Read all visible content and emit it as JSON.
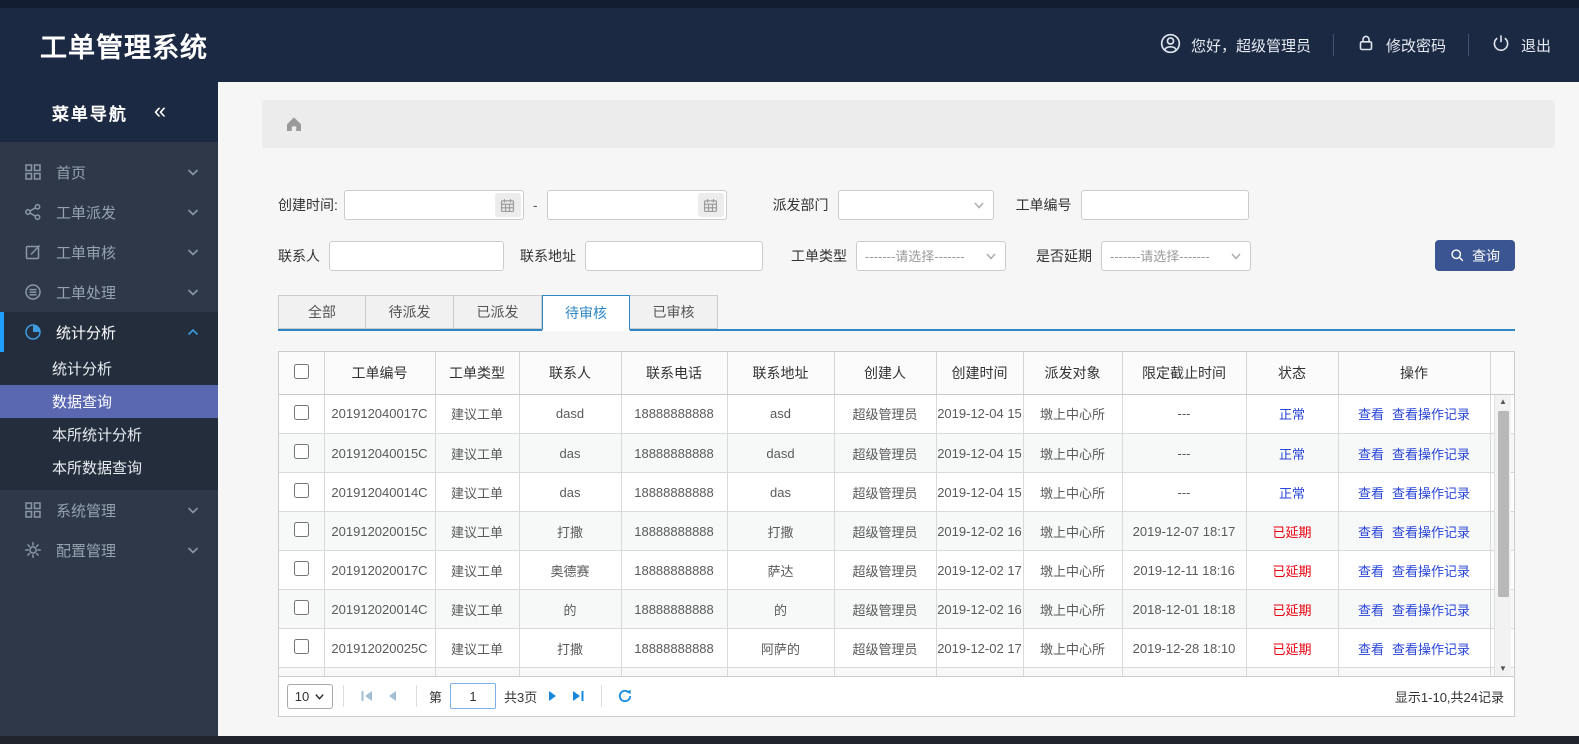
{
  "header": {
    "title": "工单管理系统",
    "greeting": "您好，超级管理员",
    "change_password": "修改密码",
    "logout": "退出"
  },
  "sidebar": {
    "title": "菜单导航",
    "collapse_glyph": "«",
    "items": [
      {
        "label": "首页",
        "icon": "grid-icon"
      },
      {
        "label": "工单派发",
        "icon": "share-icon"
      },
      {
        "label": "工单审核",
        "icon": "edit-icon"
      },
      {
        "label": "工单处理",
        "icon": "process-icon"
      },
      {
        "label": "统计分析",
        "icon": "pie-icon",
        "active": true,
        "expanded": true
      },
      {
        "label": "系统管理",
        "icon": "modules-icon"
      },
      {
        "label": "配置管理",
        "icon": "gear-icon"
      }
    ],
    "submenu": {
      "parent": "统计分析",
      "items": [
        {
          "label": "统计分析",
          "selected": false
        },
        {
          "label": "数据查询",
          "selected": true
        },
        {
          "label": "本所统计分析",
          "selected": false
        },
        {
          "label": "本所数据查询",
          "selected": false
        }
      ]
    }
  },
  "filters": {
    "create_time_label": "创建时间:",
    "range_separator": "-",
    "dispatch_dept_label": "派发部门",
    "order_no_label": "工单编号",
    "contact_label": "联系人",
    "address_label": "联系地址",
    "order_type_label": "工单类型",
    "delay_label": "是否延期",
    "select_placeholder": "-------请选择-------",
    "search_button": "查询"
  },
  "tabs": [
    {
      "label": "全部",
      "active": false
    },
    {
      "label": "待派发",
      "active": false
    },
    {
      "label": "已派发",
      "active": false
    },
    {
      "label": "待审核",
      "active": true
    },
    {
      "label": "已审核",
      "active": false
    }
  ],
  "table": {
    "columns": [
      "工单编号",
      "工单类型",
      "联系人",
      "联系电话",
      "联系地址",
      "创建人",
      "创建时间",
      "派发对象",
      "限定截止时间",
      "状态",
      "操作"
    ],
    "action_view": "查看",
    "action_view_log": "查看操作记录",
    "rows": [
      {
        "order_no": "201912040017C",
        "type": "建议工单",
        "contact": "dasd",
        "phone": "18888888888",
        "address": "asd",
        "creator": "超级管理员",
        "created": "2019-12-04 15",
        "target": "墩上中心所",
        "deadline": "---",
        "status": "正常",
        "status_class": "normal"
      },
      {
        "order_no": "201912040015C",
        "type": "建议工单",
        "contact": "das",
        "phone": "18888888888",
        "address": "dasd",
        "creator": "超级管理员",
        "created": "2019-12-04 15",
        "target": "墩上中心所",
        "deadline": "---",
        "status": "正常",
        "status_class": "normal"
      },
      {
        "order_no": "201912040014C",
        "type": "建议工单",
        "contact": "das",
        "phone": "18888888888",
        "address": "das",
        "creator": "超级管理员",
        "created": "2019-12-04 15",
        "target": "墩上中心所",
        "deadline": "---",
        "status": "正常",
        "status_class": "normal"
      },
      {
        "order_no": "201912020015C",
        "type": "建议工单",
        "contact": "打撒",
        "phone": "18888888888",
        "address": "打撒",
        "creator": "超级管理员",
        "created": "2019-12-02 16",
        "target": "墩上中心所",
        "deadline": "2019-12-07 18:17",
        "status": "已延期",
        "status_class": "delayed"
      },
      {
        "order_no": "201912020017C",
        "type": "建议工单",
        "contact": "奥德赛",
        "phone": "18888888888",
        "address": "萨达",
        "creator": "超级管理员",
        "created": "2019-12-02 17",
        "target": "墩上中心所",
        "deadline": "2019-12-11 18:16",
        "status": "已延期",
        "status_class": "delayed"
      },
      {
        "order_no": "201912020014C",
        "type": "建议工单",
        "contact": "的",
        "phone": "18888888888",
        "address": "的",
        "creator": "超级管理员",
        "created": "2019-12-02 16",
        "target": "墩上中心所",
        "deadline": "2018-12-01 18:18",
        "status": "已延期",
        "status_class": "delayed"
      },
      {
        "order_no": "201912020025C",
        "type": "建议工单",
        "contact": "打撒",
        "phone": "18888888888",
        "address": "阿萨的",
        "creator": "超级管理员",
        "created": "2019-12-02 17",
        "target": "墩上中心所",
        "deadline": "2019-12-28 18:10",
        "status": "已延期",
        "status_class": "delayed"
      }
    ]
  },
  "scrollbar": {
    "up_glyph": "▲",
    "down_glyph": "▼"
  },
  "pagination": {
    "page_size": "10",
    "page_prefix": "第",
    "current_page": "1",
    "total_pages": "共3页",
    "summary": "显示1-10,共24记录"
  },
  "colors": {
    "topbar_bg": "#1b2942",
    "sidebar_bg": "#2e3848",
    "submenu_selected_bg": "#5a68b2",
    "accent_bar": "#1e9fff",
    "tab_active": "#2c87c5",
    "search_button_bg": "#3a5591",
    "status_normal": "#2945d9",
    "status_delayed": "#e8000d",
    "link_blue": "#2945d9",
    "pager_blue": "#1789dc"
  }
}
